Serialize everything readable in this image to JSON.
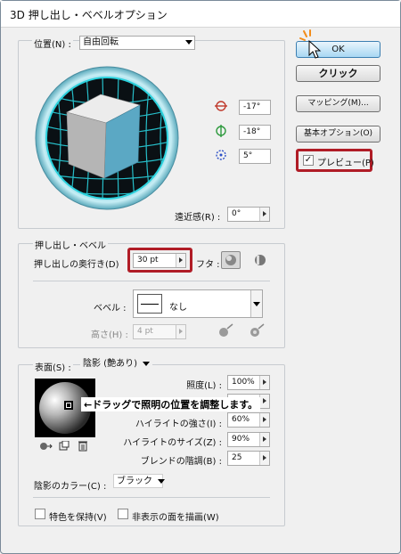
{
  "window": {
    "title": "3D 押し出し・ベベルオプション"
  },
  "position": {
    "label": "位置(N) :",
    "value": "自由回転",
    "rot_x": "-17°",
    "rot_y": "-18°",
    "rot_z": "5°",
    "perspective_label": "遠近感(R) :",
    "perspective_value": "0°"
  },
  "buttons": {
    "ok": "OK",
    "click_note": "クリック",
    "mapping": "マッピング(M)...",
    "basic_options": "基本オプション(O)",
    "preview": "プレビュー(P)",
    "preview_checked": "✓"
  },
  "extrude": {
    "group_label": "押し出し・ベベル",
    "depth_label": "押し出しの奥行き(D)",
    "depth_value": "30 pt",
    "cap_label": "フタ :",
    "bevel_label": "ベベル :",
    "bevel_value": "なし",
    "height_label": "高さ(H) :",
    "height_value": "4 pt"
  },
  "surface": {
    "label": "表面(S) :",
    "value": "陰影 (艶あり)",
    "rows": [
      {
        "label": "照度(L) :",
        "value": "100%"
      },
      {
        "label": "",
        "value": ""
      },
      {
        "label": "ハイライトの強さ(I) :",
        "value": "60%"
      },
      {
        "label": "ハイライトのサイズ(Z) :",
        "value": "90%"
      },
      {
        "label": "ブレンドの階調(B) :",
        "value": "25"
      }
    ],
    "shade_label": "陰影のカラー(C) :",
    "shade_value": "ブラック",
    "preserve_spot": "特色を保持(V)",
    "draw_hidden": "非表示の面を描画(W)",
    "annotation": "←ドラッグで照明の位置を調整します。"
  },
  "colors": {
    "highlight_box": "#b01c26",
    "cube_front": "#5ba8c4",
    "cube_top": "#ececec",
    "cube_side": "#b5b5b5",
    "grid": "#2ad1dc"
  }
}
